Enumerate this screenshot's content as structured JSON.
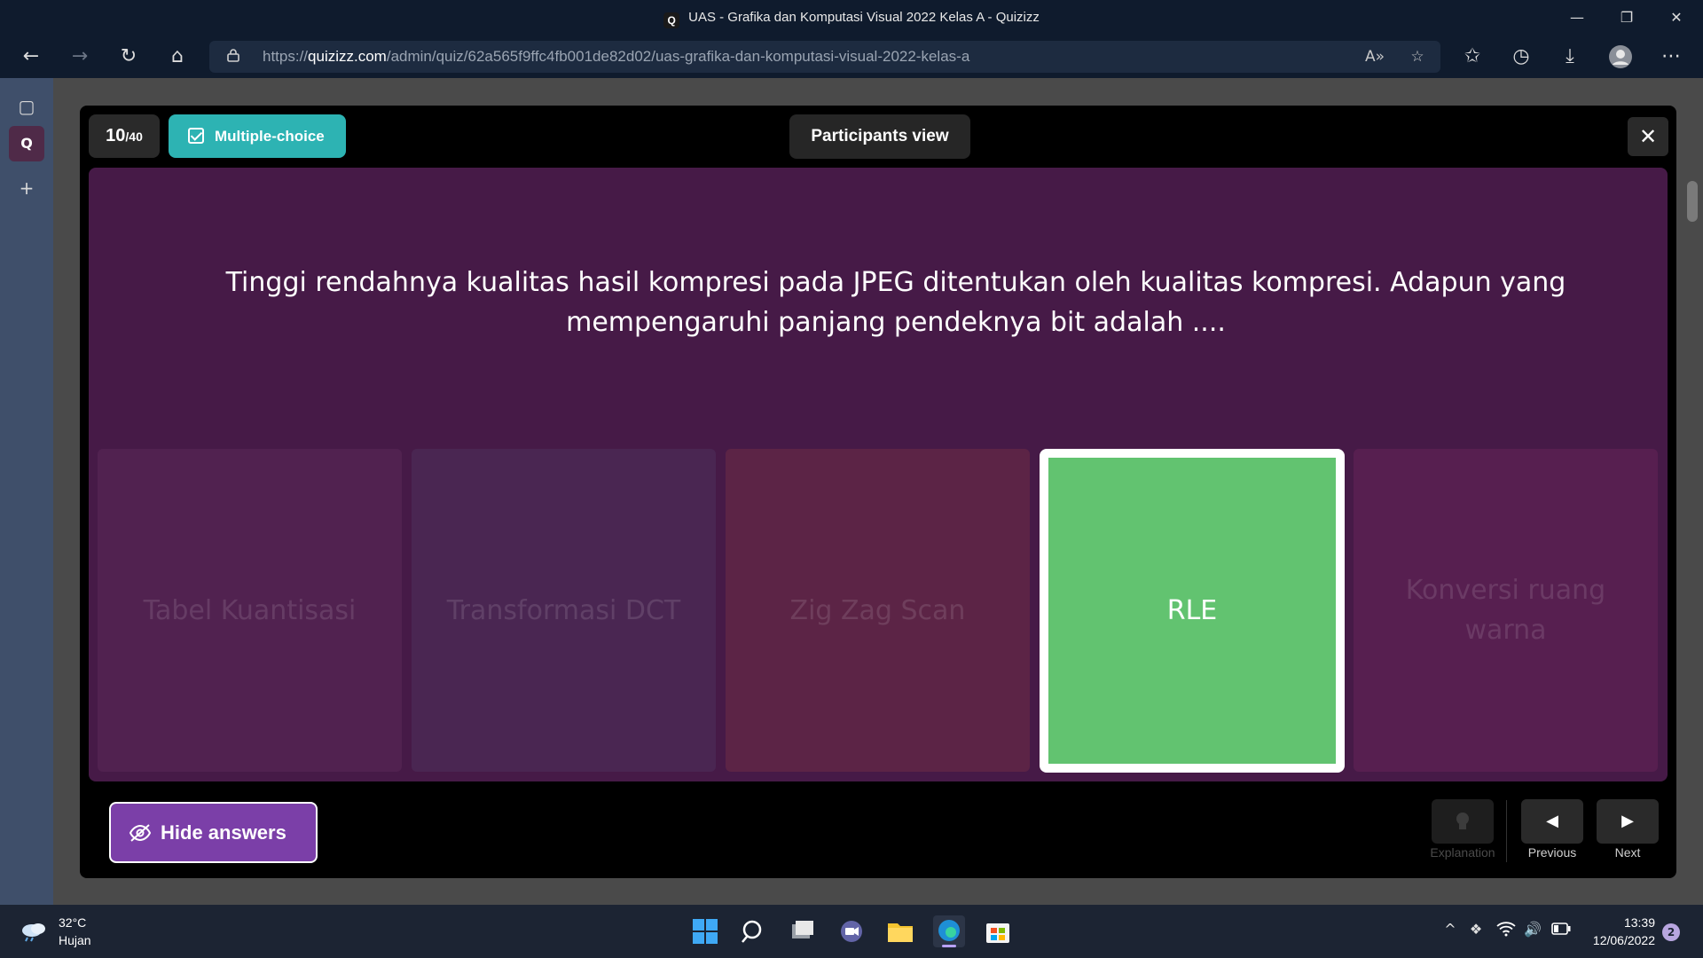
{
  "browser": {
    "window_title": "UAS - Grafika dan Komputasi Visual 2022 Kelas A - Quizizz",
    "tab_favicon": "Q",
    "url_prefix": "https://",
    "url_domain": "quizizz.com",
    "url_path": "/admin/quiz/62a565f9ffc4fb001de82d02/uas-grafika-dan-komputasi-visual-2022-kelas-a",
    "icons": [
      "back-icon",
      "forward-icon",
      "refresh-icon",
      "home-icon",
      "lock-icon",
      "read-aloud-icon",
      "add-favorite-icon",
      "favorites-icon",
      "history-icon",
      "download-icon",
      "profile-icon",
      "more-icon"
    ]
  },
  "sidebar": {
    "items": [
      {
        "icon": "tabs-icon",
        "glyph": "▢"
      },
      {
        "icon": "quizizz-tab-icon",
        "glyph": "Q"
      },
      {
        "icon": "add-icon",
        "glyph": "+"
      }
    ]
  },
  "modal": {
    "question_number": "10",
    "question_total": "/40",
    "question_type": "Multiple-choice",
    "participants_view": "Participants view",
    "close_glyph": "✕",
    "question_text": "Tinggi rendahnya kualitas hasil kompresi pada JPEG ditentukan oleh kualitas kompresi. Adapun yang mempengaruhi panjang pendeknya bit adalah ....",
    "options": [
      {
        "text": "Tabel Kuantisasi",
        "correct": false
      },
      {
        "text": "Transformasi DCT",
        "correct": false
      },
      {
        "text": "Zig Zag Scan",
        "correct": false
      },
      {
        "text": "RLE",
        "correct": true
      },
      {
        "text": "Konversi ruang warna",
        "correct": false
      }
    ],
    "hide_answers_label": "Hide answers",
    "explanation_label": "Explanation",
    "previous_label": "Previous",
    "next_label": "Next",
    "colors": {
      "question_bg": "#461a47",
      "correct_bg": "#62c370",
      "type_badge": "#2db3b3",
      "hide_button": "#7b3fa8"
    }
  },
  "taskbar": {
    "temperature": "32°C",
    "condition": "Hujan",
    "time": "13:39",
    "date": "12/06/2022",
    "notification_count": "2"
  }
}
